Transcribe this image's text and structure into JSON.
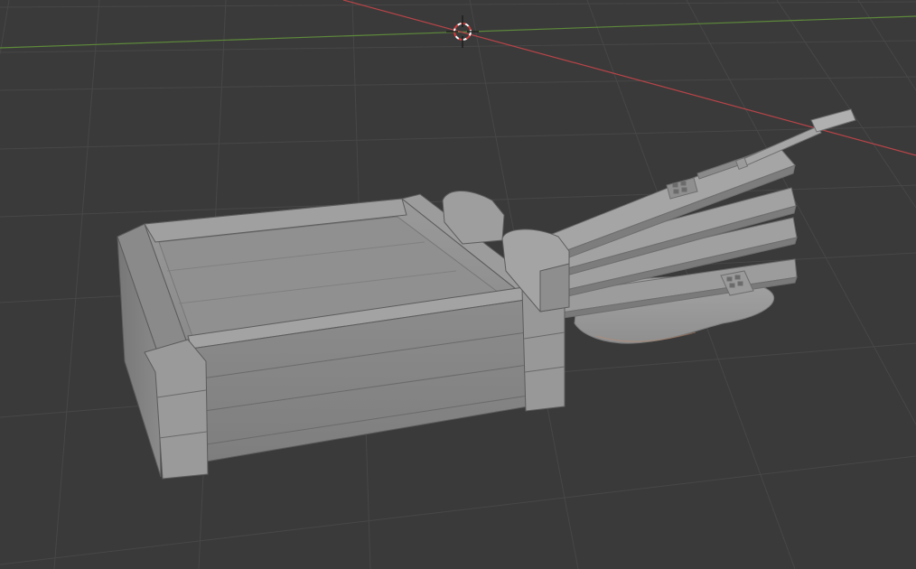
{
  "viewport": {
    "mode": "3d-viewport",
    "shading": "solid",
    "background_color": "#393939",
    "grid_color": "#444444",
    "x_axis_color": "#b84448",
    "y_axis_color": "#5e8a3a",
    "object_color": "#8e8e8e"
  },
  "scene": {
    "objects": [
      {
        "name": "crate",
        "icon": "box-icon"
      },
      {
        "name": "lid-planks",
        "icon": "plank-icon"
      },
      {
        "name": "rod",
        "icon": "rod-icon"
      },
      {
        "name": "base-blob",
        "icon": "mesh-icon"
      }
    ],
    "cursor_icon": "3d-cursor-icon"
  }
}
